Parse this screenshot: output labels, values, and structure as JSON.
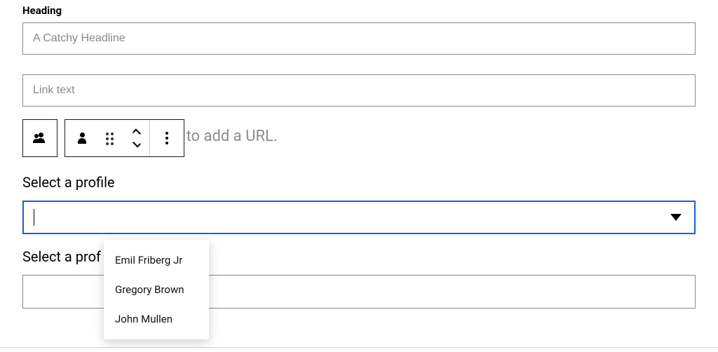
{
  "heading_field": {
    "label": "Heading",
    "placeholder": "A Catchy Headline"
  },
  "link_field": {
    "placeholder": "Link text"
  },
  "toolbar_hint_partial": "se the toolbar to add a URL.",
  "profile_select_1": {
    "label": "Select a profile",
    "options": [
      "Emil Friberg Jr",
      "Gregory Brown",
      "John Mullen"
    ]
  },
  "profile_select_2": {
    "label_partial": "Select a prof"
  }
}
